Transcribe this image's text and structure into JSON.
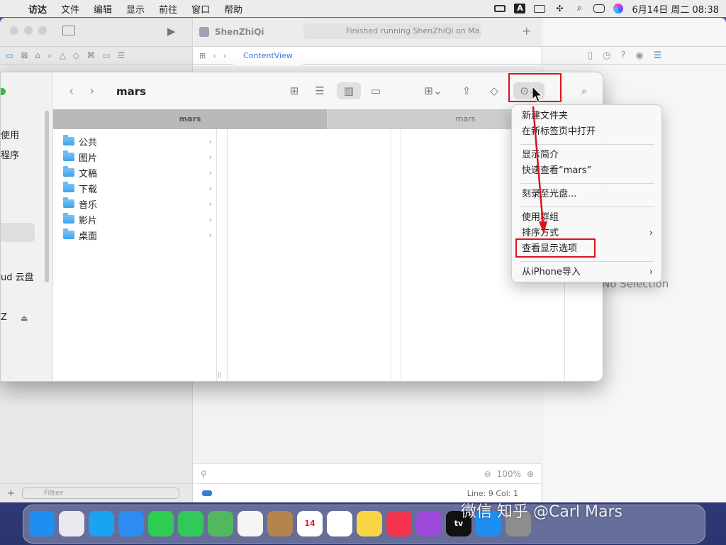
{
  "menubar": {
    "app": "访达",
    "items": [
      "文件",
      "编辑",
      "显示",
      "前往",
      "窗口",
      "帮助"
    ],
    "status_a": "A",
    "datetime": "6月14日 周二  08:38"
  },
  "xcode": {
    "project": "ShenZhiQi",
    "status": "Finished running ShenZhiQi on Ma...",
    "editor_tab": "ContentView",
    "inspector_empty": "No Selection",
    "zoom": "100%",
    "line_col": "Line: 9  Col: 1",
    "filter_placeholder": "Filter"
  },
  "finder": {
    "title": "mars",
    "column_header_1": "mars",
    "column_header_2": "mars",
    "sidebar_labels": [
      "使用",
      "程序",
      "ud 云盘",
      "Z"
    ],
    "folders": [
      "公共",
      "图片",
      "文稿",
      "下载",
      "音乐",
      "影片",
      "桌面"
    ]
  },
  "context_menu": {
    "groups": [
      [
        "新建文件夹",
        "在新标签页中打开"
      ],
      [
        "显示简介",
        "快速查看“mars”"
      ],
      [
        "刻录至光盘..."
      ],
      [
        "使用群组",
        "排序方式",
        "查看显示选项"
      ],
      [
        "从iPhone导入"
      ]
    ],
    "submenu_arrow": "›"
  },
  "dock": {
    "apps": [
      {
        "name": "Finder",
        "label": "",
        "color": "#1e8ff0"
      },
      {
        "name": "Launchpad",
        "label": "",
        "color": "#e9e9ef"
      },
      {
        "name": "Safari",
        "label": "",
        "color": "#1aa3f0"
      },
      {
        "name": "Mail",
        "label": "",
        "color": "#2c8cf0"
      },
      {
        "name": "FaceTime",
        "label": "",
        "color": "#2ecc52"
      },
      {
        "name": "Messages",
        "label": "",
        "color": "#33c85a"
      },
      {
        "name": "Maps",
        "label": "",
        "color": "#52b85f"
      },
      {
        "name": "Photos",
        "label": "",
        "color": "#f5f5f5"
      },
      {
        "name": "Contacts",
        "label": "",
        "color": "#b4834e"
      },
      {
        "name": "Calendar",
        "label": "14",
        "color": "#ffffff"
      },
      {
        "name": "Reminders",
        "label": "",
        "color": "#ffffff"
      },
      {
        "name": "Notes",
        "label": "",
        "color": "#f8d547"
      },
      {
        "name": "Music",
        "label": "",
        "color": "#f5344e"
      },
      {
        "name": "Podcasts",
        "label": "",
        "color": "#9c48d8"
      },
      {
        "name": "TV",
        "label": "tv",
        "color": "#111111"
      },
      {
        "name": "App Store",
        "label": "",
        "color": "#1e8ff0"
      },
      {
        "name": "System Preferences",
        "label": "",
        "color": "#8d8d8d"
      }
    ]
  },
  "watermark": "微信   知乎 @Carl Mars",
  "colors": {
    "accent": "#3a7bd5",
    "highlight": "#d9141c"
  }
}
